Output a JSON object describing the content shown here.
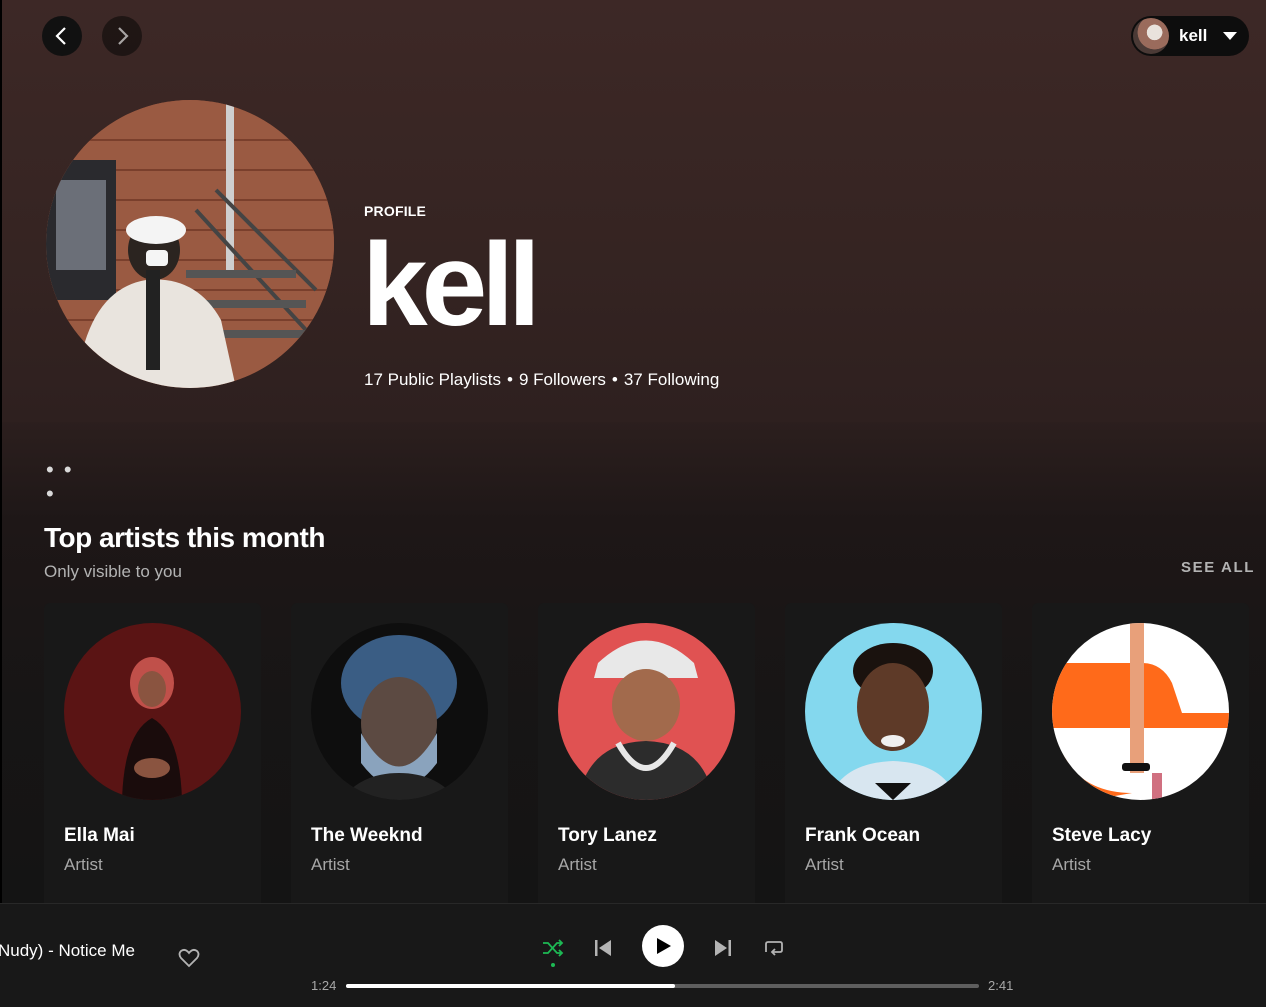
{
  "nav": {
    "back_icon": "chevron-left-icon",
    "forward_icon": "chevron-right-icon"
  },
  "user_menu": {
    "name": "kell",
    "icon": "caret-down-icon"
  },
  "profile": {
    "label": "PROFILE",
    "name": "kell",
    "playlists": "17 Public Playlists",
    "followers": "9 Followers",
    "following": "37 Following",
    "separator": "•",
    "more_label": "• • •"
  },
  "top_artists": {
    "title": "Top artists this month",
    "subtitle": "Only visible to you",
    "see_all": "SEE ALL",
    "artists": [
      {
        "name": "Ella Mai",
        "type": "Artist",
        "color": "#5a1414"
      },
      {
        "name": "The Weeknd",
        "type": "Artist",
        "color": "#0e0e0e"
      },
      {
        "name": "Tory Lanez",
        "type": "Artist",
        "color": "#e05252"
      },
      {
        "name": "Frank Ocean",
        "type": "Artist",
        "color": "#84d8ee"
      },
      {
        "name": "Steve Lacy",
        "type": "Artist",
        "color": "#ff6a1a"
      }
    ]
  },
  "player": {
    "track": "Nudy) - Notice Me",
    "current_time": "1:24",
    "duration": "2:41",
    "progress": 0.52,
    "accent": "#1db954",
    "shuffle_on": true
  }
}
